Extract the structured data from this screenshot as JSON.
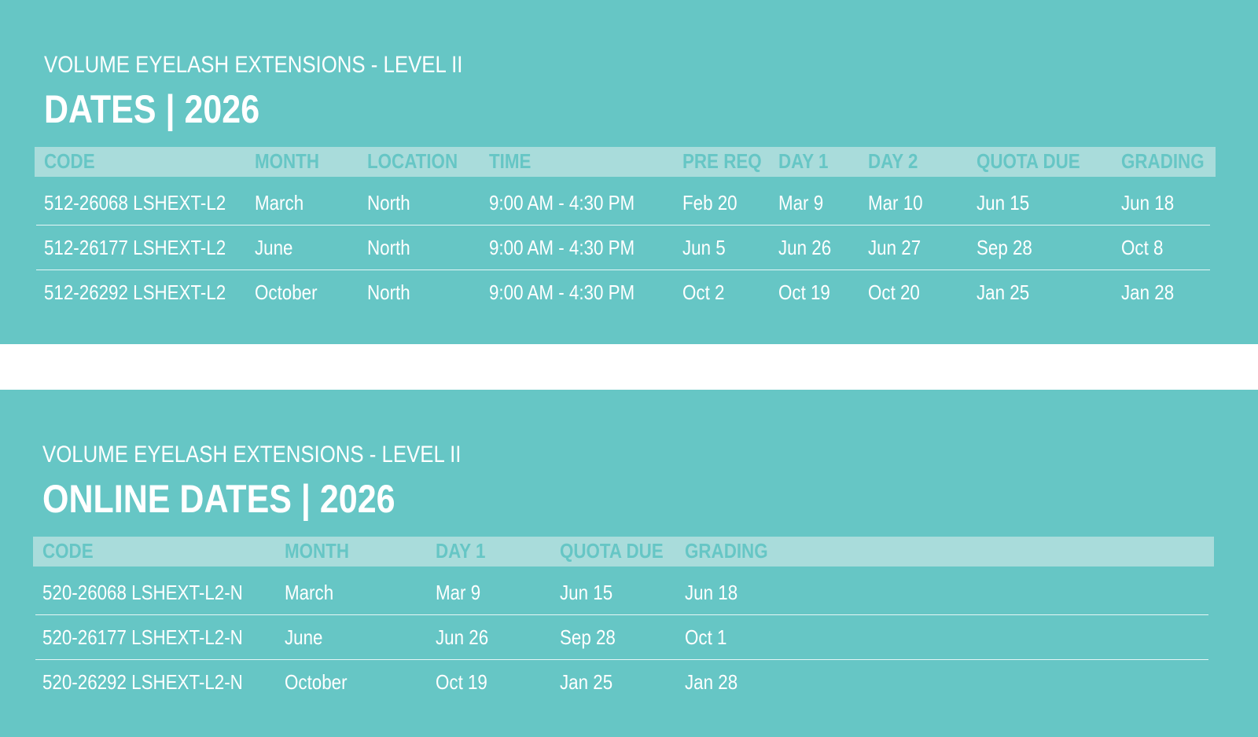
{
  "section1": {
    "subtitle": "VOLUME EYELASH EXTENSIONS - LEVEL II",
    "title": "DATES  |  2026",
    "headers": [
      "CODE",
      "MONTH",
      "LOCATION",
      "TIME",
      "PRE REQ",
      "DAY 1",
      "DAY 2",
      "QUOTA DUE",
      "GRADING"
    ],
    "rows": [
      [
        "512-26068 LSHEXT-L2",
        "March",
        "North",
        "9:00 AM - 4:30 PM",
        "Feb 20",
        "Mar 9",
        "Mar 10",
        "Jun 15",
        "Jun 18"
      ],
      [
        "512-26177 LSHEXT-L2",
        "June",
        "North",
        "9:00 AM - 4:30 PM",
        "Jun 5",
        "Jun 26",
        "Jun 27",
        "Sep 28",
        "Oct 8"
      ],
      [
        "512-26292 LSHEXT-L2",
        "October",
        "North",
        "9:00 AM - 4:30 PM",
        "Oct 2",
        "Oct 19",
        "Oct 20",
        "Jan 25",
        "Jan 28"
      ]
    ]
  },
  "section2": {
    "subtitle": "VOLUME EYELASH EXTENSIONS - LEVEL II",
    "title": "ONLINE DATES  |  2026",
    "headers": [
      "CODE",
      "MONTH",
      "DAY 1",
      "QUOTA DUE",
      "GRADING"
    ],
    "rows": [
      [
        "520-26068 LSHEXT-L2-N",
        "March",
        "Mar 9",
        "Jun 15",
        "Jun 18"
      ],
      [
        "520-26177 LSHEXT-L2-N",
        "June",
        "Jun 26",
        "Sep 28",
        "Oct 1"
      ],
      [
        "520-26292 LSHEXT-L2-N",
        "October",
        "Oct 19",
        "Jan 25",
        "Jan 28"
      ]
    ]
  },
  "colors": {
    "panel": "#66c6c5",
    "header_bar": "#a9dcdb",
    "text": "#ffffff"
  }
}
